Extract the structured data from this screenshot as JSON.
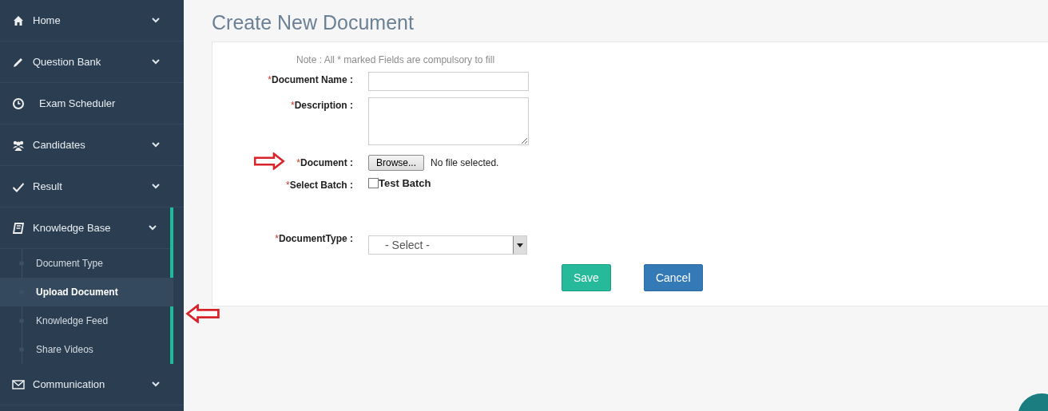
{
  "sidebar": {
    "items": [
      {
        "label": "Home",
        "kind": "group"
      },
      {
        "label": "Question Bank",
        "kind": "group"
      },
      {
        "label": "Exam Scheduler",
        "kind": "link"
      },
      {
        "label": "Candidates",
        "kind": "group"
      },
      {
        "label": "Result",
        "kind": "group"
      },
      {
        "label": "Knowledge Base",
        "kind": "group",
        "expanded": true,
        "children": [
          {
            "label": "Document Type",
            "selected": false
          },
          {
            "label": "Upload Document",
            "selected": true
          },
          {
            "label": "Knowledge Feed",
            "selected": false
          },
          {
            "label": "Share Videos",
            "selected": false
          }
        ]
      },
      {
        "label": "Communication",
        "kind": "group"
      }
    ]
  },
  "page": {
    "title": "Create New Document"
  },
  "form": {
    "note": "Note : All * marked Fields are compulsory to fill",
    "fields": [
      {
        "kind": "text",
        "required_mark": "*",
        "label": "Document Name :"
      },
      {
        "kind": "textarea",
        "required_mark": "*",
        "label": "Description :"
      },
      {
        "kind": "file",
        "required_mark": "*",
        "label": "Document :",
        "button": "Browse...",
        "status": "No file selected.",
        "annotated": true
      },
      {
        "kind": "checkbox",
        "required_mark": "*",
        "label": "Select Batch :",
        "option": "Test Batch",
        "checked": false
      },
      {
        "kind": "select",
        "required_mark": "*",
        "label": "DocumentType :",
        "value": "- Select -"
      }
    ],
    "buttons": [
      {
        "label": "Save",
        "kind": "primary"
      },
      {
        "label": "Cancel",
        "kind": "secondary"
      }
    ]
  }
}
